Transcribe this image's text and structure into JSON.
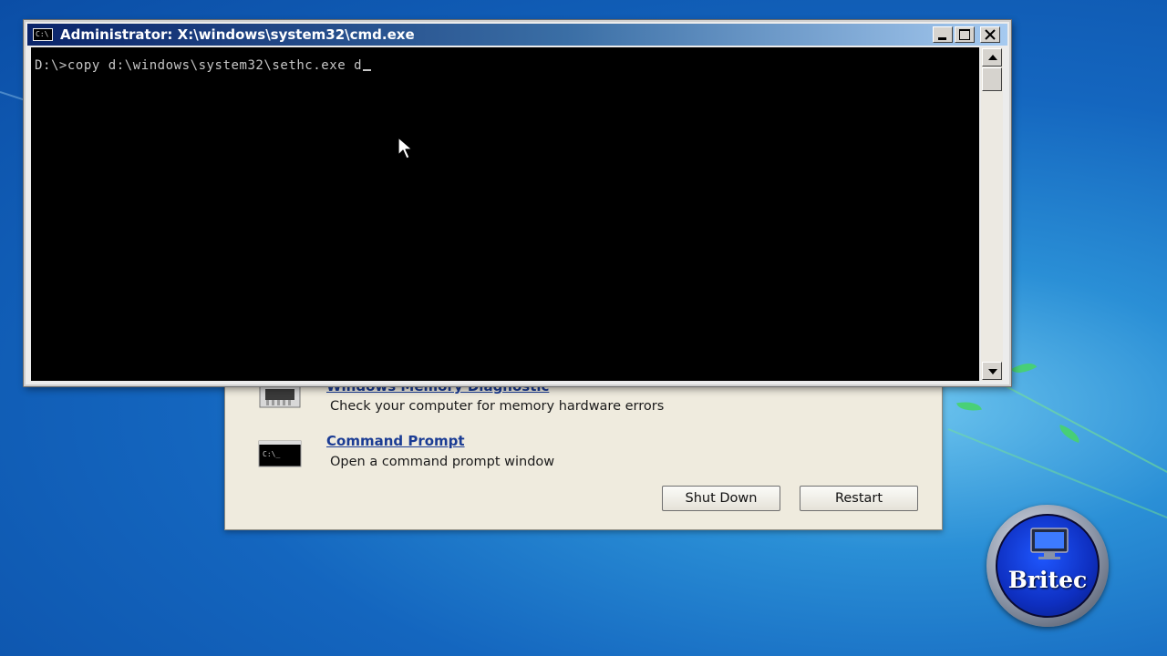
{
  "cmd_window": {
    "title": "Administrator: X:\\windows\\system32\\cmd.exe",
    "icon_label": "C:\\",
    "console_text": "D:\\>copy d:\\windows\\system32\\sethc.exe d"
  },
  "recovery_options": {
    "items": [
      {
        "title": "Windows Memory Diagnostic",
        "description": "Check your computer for memory hardware errors",
        "icon": "memory-chip-icon"
      },
      {
        "title": "Command Prompt",
        "description": "Open a command prompt window",
        "icon": "command-prompt-icon"
      }
    ],
    "shutdown_label": "Shut Down",
    "restart_label": "Restart"
  },
  "watermark": {
    "text": "Britec"
  },
  "colors": {
    "desktop_blue": "#1466bf",
    "title_bar": "#0a246a",
    "console_bg": "#000000",
    "link": "#1b3c94"
  }
}
